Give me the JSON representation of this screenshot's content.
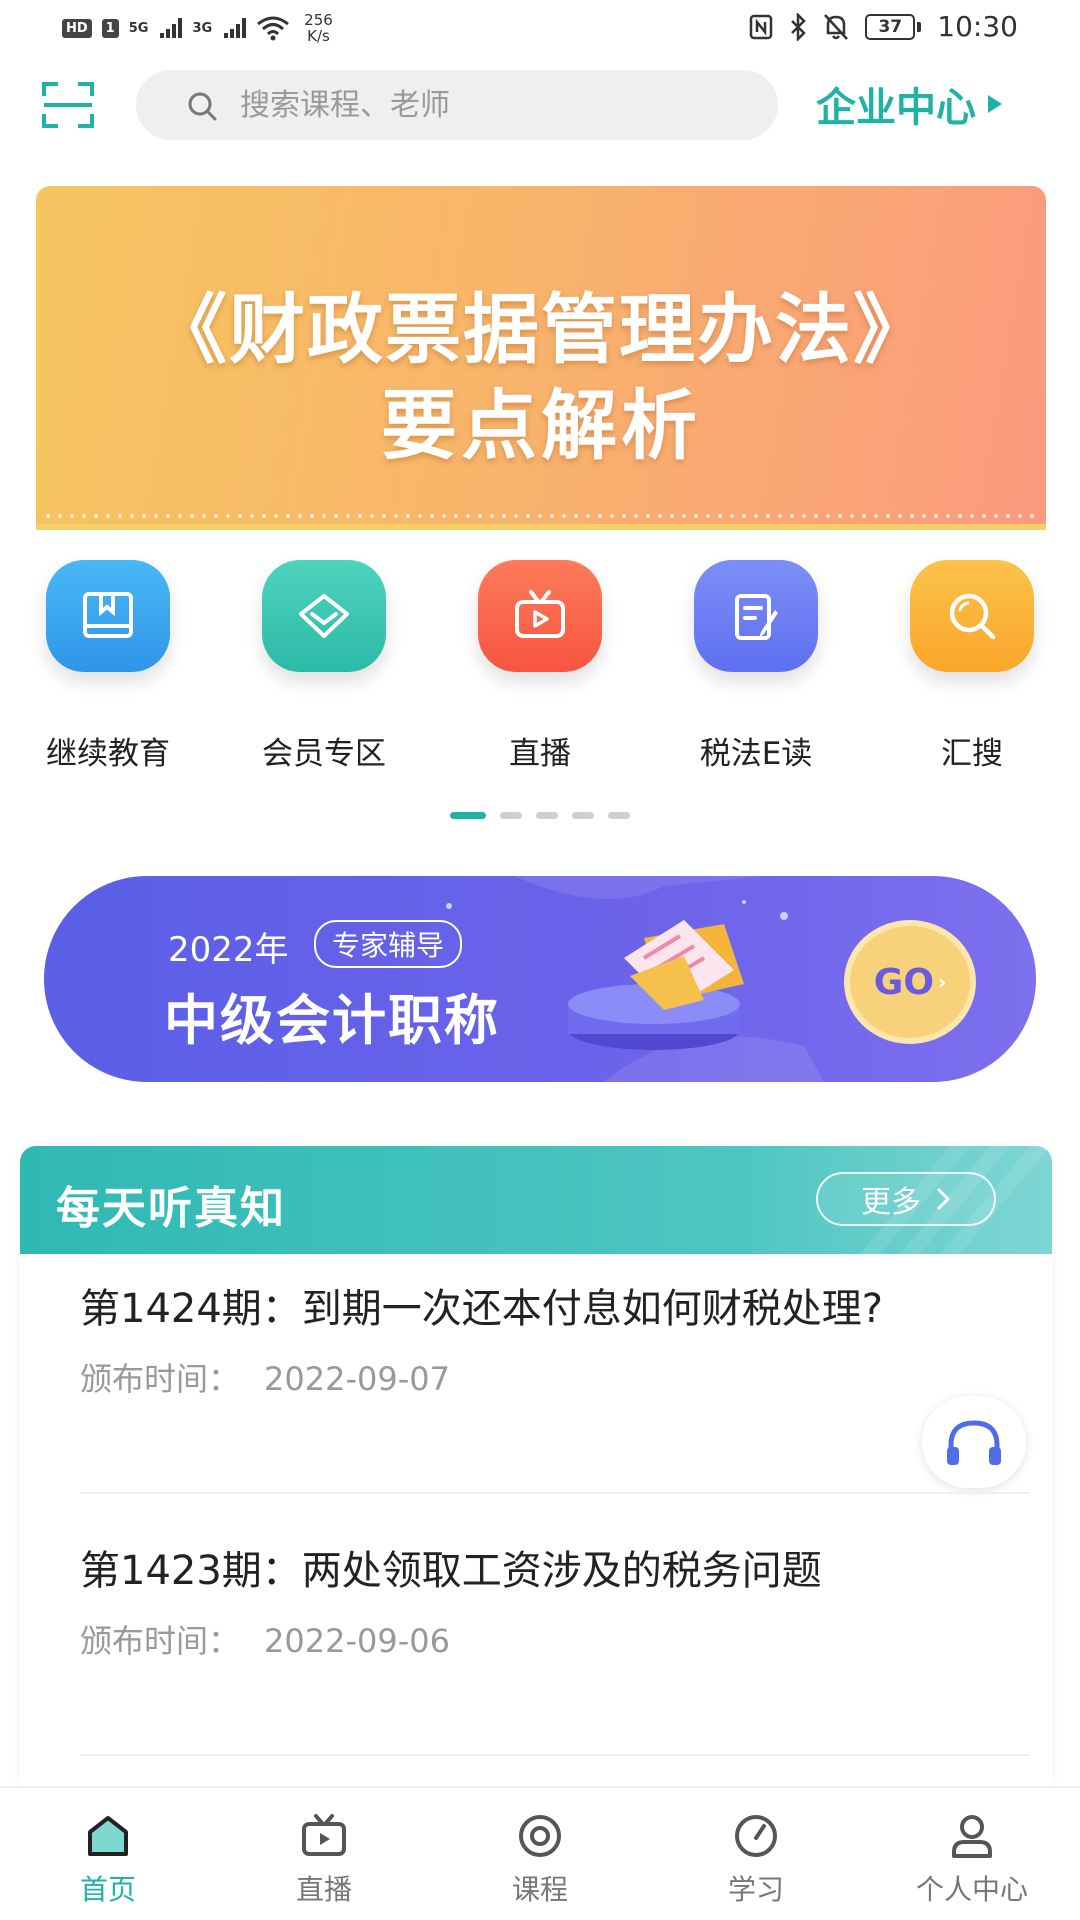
{
  "status_bar": {
    "hd": "HD",
    "sim1": "1",
    "net1": "5G",
    "net2": "3G",
    "speed_value": "256",
    "speed_unit": "K/s",
    "battery": "37",
    "time": "10:30"
  },
  "header": {
    "search_placeholder": "搜索课程、老师",
    "enterprise_label": "企业中心"
  },
  "banner": {
    "line1": "《财政票据管理办法》",
    "line2": "要点解析",
    "colors": {
      "start": "#f6c560",
      "end": "#fb9a7e"
    }
  },
  "quick_entries": [
    {
      "label": "继续教育",
      "icon": "book-icon",
      "color": "#3aa8ef"
    },
    {
      "label": "会员专区",
      "icon": "diamond-icon",
      "color": "#39c9b4"
    },
    {
      "label": "直播",
      "icon": "tv-play-icon",
      "color": "#fb6a4e"
    },
    {
      "label": "税法E读",
      "icon": "document-edit-icon",
      "color": "#6a7bf1"
    },
    {
      "label": "汇搜",
      "icon": "search-icon",
      "color": "#fbb336"
    }
  ],
  "pager": {
    "pages": 5,
    "active": 1
  },
  "promo": {
    "year": "2022年",
    "tag": "专家辅导",
    "title": "中级会计职称",
    "go": "GO"
  },
  "daily": {
    "title": "每天听真知",
    "more": "更多",
    "episodes": [
      {
        "title": "第1424期：到期一次还本付息如何财税处理?",
        "date_label": "颁布时间：",
        "date": "2022-09-07"
      },
      {
        "title": "第1423期：两处领取工资涉及的税务问题",
        "date_label": "颁布时间：",
        "date": "2022-09-06"
      }
    ]
  },
  "tabbar": {
    "accent": "#1eb3a5",
    "tabs": [
      {
        "label": "首页",
        "icon": "home-icon",
        "active": true
      },
      {
        "label": "直播",
        "icon": "tv-play-icon",
        "active": false
      },
      {
        "label": "课程",
        "icon": "course-icon",
        "active": false
      },
      {
        "label": "学习",
        "icon": "compass-icon",
        "active": false
      },
      {
        "label": "个人中心",
        "icon": "user-icon",
        "active": false
      }
    ]
  }
}
